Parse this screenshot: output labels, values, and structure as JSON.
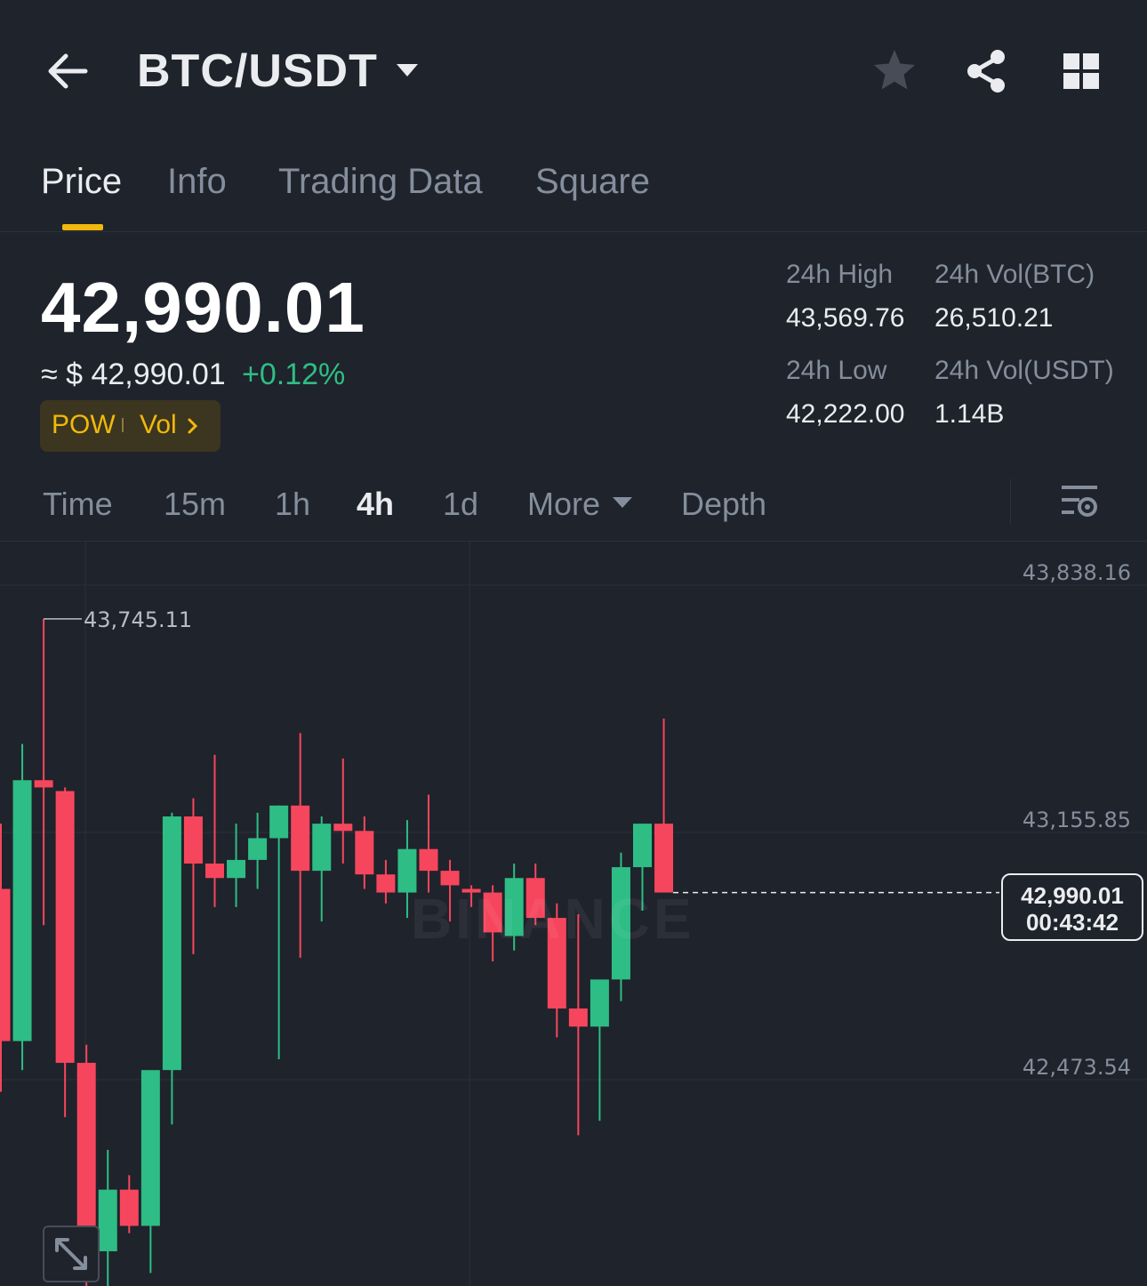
{
  "header": {
    "pair": "BTC/USDT",
    "icons": [
      "back-arrow-icon",
      "caret-down-icon",
      "star-icon",
      "share-icon",
      "grid-icon"
    ]
  },
  "tabs": [
    {
      "label": "Price",
      "active": true
    },
    {
      "label": "Info",
      "active": false
    },
    {
      "label": "Trading Data",
      "active": false
    },
    {
      "label": "Square",
      "active": false
    }
  ],
  "ticker": {
    "last_price": "42,990.01",
    "approx_usd": "≈ $ 42,990.01",
    "change": "+0.12%",
    "tag_pow": "POW",
    "tag_vol": "Vol"
  },
  "stats": {
    "high_label": "24h High",
    "high_value": "43,569.76",
    "vol_btc_label": "24h Vol(BTC)",
    "vol_btc_value": "26,510.21",
    "low_label": "24h Low",
    "low_value": "42,222.00",
    "vol_usdt_label": "24h Vol(USDT)",
    "vol_usdt_value": "1.14B"
  },
  "intervals": [
    {
      "label": "Time",
      "active": false
    },
    {
      "label": "15m",
      "active": false
    },
    {
      "label": "1h",
      "active": false
    },
    {
      "label": "4h",
      "active": true
    },
    {
      "label": "1d",
      "active": false
    },
    {
      "label": "More",
      "active": false
    },
    {
      "label": "Depth",
      "active": false
    }
  ],
  "colors": {
    "up": "#2ebd85",
    "down": "#f6465d",
    "accent": "#f0b90b",
    "background": "#1f232b"
  },
  "chart_data": {
    "type": "candlestick",
    "y_ticks": [
      "43,838.16",
      "43,155.85",
      "42,473.54"
    ],
    "y_tick_values": [
      43838.16,
      43155.85,
      42473.54
    ],
    "ylim": [
      41900,
      43932
    ],
    "visible_high_label": "43,745.11",
    "visible_high_value": 43745.11,
    "current_price": "42,990.01",
    "current_price_value": 42990.01,
    "countdown": "00:43:42",
    "watermark": "BINANCE",
    "candles": [
      {
        "o": 43000,
        "h": 43180,
        "l": 42440,
        "c": 42580
      },
      {
        "o": 42580,
        "h": 43400,
        "l": 42500,
        "c": 43300
      },
      {
        "o": 43300,
        "h": 43745.11,
        "l": 42900,
        "c": 43280
      },
      {
        "o": 43270,
        "h": 43280,
        "l": 42370,
        "c": 42520
      },
      {
        "o": 42520,
        "h": 42570,
        "l": 41900,
        "c": 42000
      },
      {
        "o": 42000,
        "h": 42280,
        "l": 41900,
        "c": 42170
      },
      {
        "o": 42170,
        "h": 42210,
        "l": 42050,
        "c": 42070
      },
      {
        "o": 42070,
        "h": 42290,
        "l": 41940,
        "c": 42500
      },
      {
        "o": 42500,
        "h": 43210,
        "l": 42350,
        "c": 43200
      },
      {
        "o": 43200,
        "h": 43250,
        "l": 42820,
        "c": 43070
      },
      {
        "o": 43070,
        "h": 43370,
        "l": 42950,
        "c": 43030
      },
      {
        "o": 43030,
        "h": 43180,
        "l": 42950,
        "c": 43080
      },
      {
        "o": 43080,
        "h": 43210,
        "l": 43000,
        "c": 43140
      },
      {
        "o": 43140,
        "h": 43230,
        "l": 42530,
        "c": 43230
      },
      {
        "o": 43230,
        "h": 43430,
        "l": 42810,
        "c": 43050
      },
      {
        "o": 43050,
        "h": 43200,
        "l": 42910,
        "c": 43180
      },
      {
        "o": 43180,
        "h": 43360,
        "l": 43070,
        "c": 43160
      },
      {
        "o": 43160,
        "h": 43200,
        "l": 43000,
        "c": 43040
      },
      {
        "o": 43040,
        "h": 43080,
        "l": 42960,
        "c": 42990
      },
      {
        "o": 42990,
        "h": 43190,
        "l": 42920,
        "c": 43110
      },
      {
        "o": 43110,
        "h": 43260,
        "l": 42990,
        "c": 43050
      },
      {
        "o": 43050,
        "h": 43080,
        "l": 42910,
        "c": 43010
      },
      {
        "o": 43000,
        "h": 43010,
        "l": 42950,
        "c": 42990
      },
      {
        "o": 42990,
        "h": 43010,
        "l": 42800,
        "c": 42880
      },
      {
        "o": 42870,
        "h": 43070,
        "l": 42830,
        "c": 43030
      },
      {
        "o": 43030,
        "h": 43070,
        "l": 42900,
        "c": 42920
      },
      {
        "o": 42920,
        "h": 42960,
        "l": 42590,
        "c": 42670
      },
      {
        "o": 42670,
        "h": 42930,
        "l": 42320,
        "c": 42620
      },
      {
        "o": 42620,
        "h": 42670,
        "l": 42360,
        "c": 42750
      },
      {
        "o": 42750,
        "h": 43100,
        "l": 42690,
        "c": 43060
      },
      {
        "o": 43060,
        "h": 43180,
        "l": 42940,
        "c": 43180
      },
      {
        "o": 43180,
        "h": 43470,
        "l": 42990,
        "c": 42990.01
      }
    ]
  }
}
